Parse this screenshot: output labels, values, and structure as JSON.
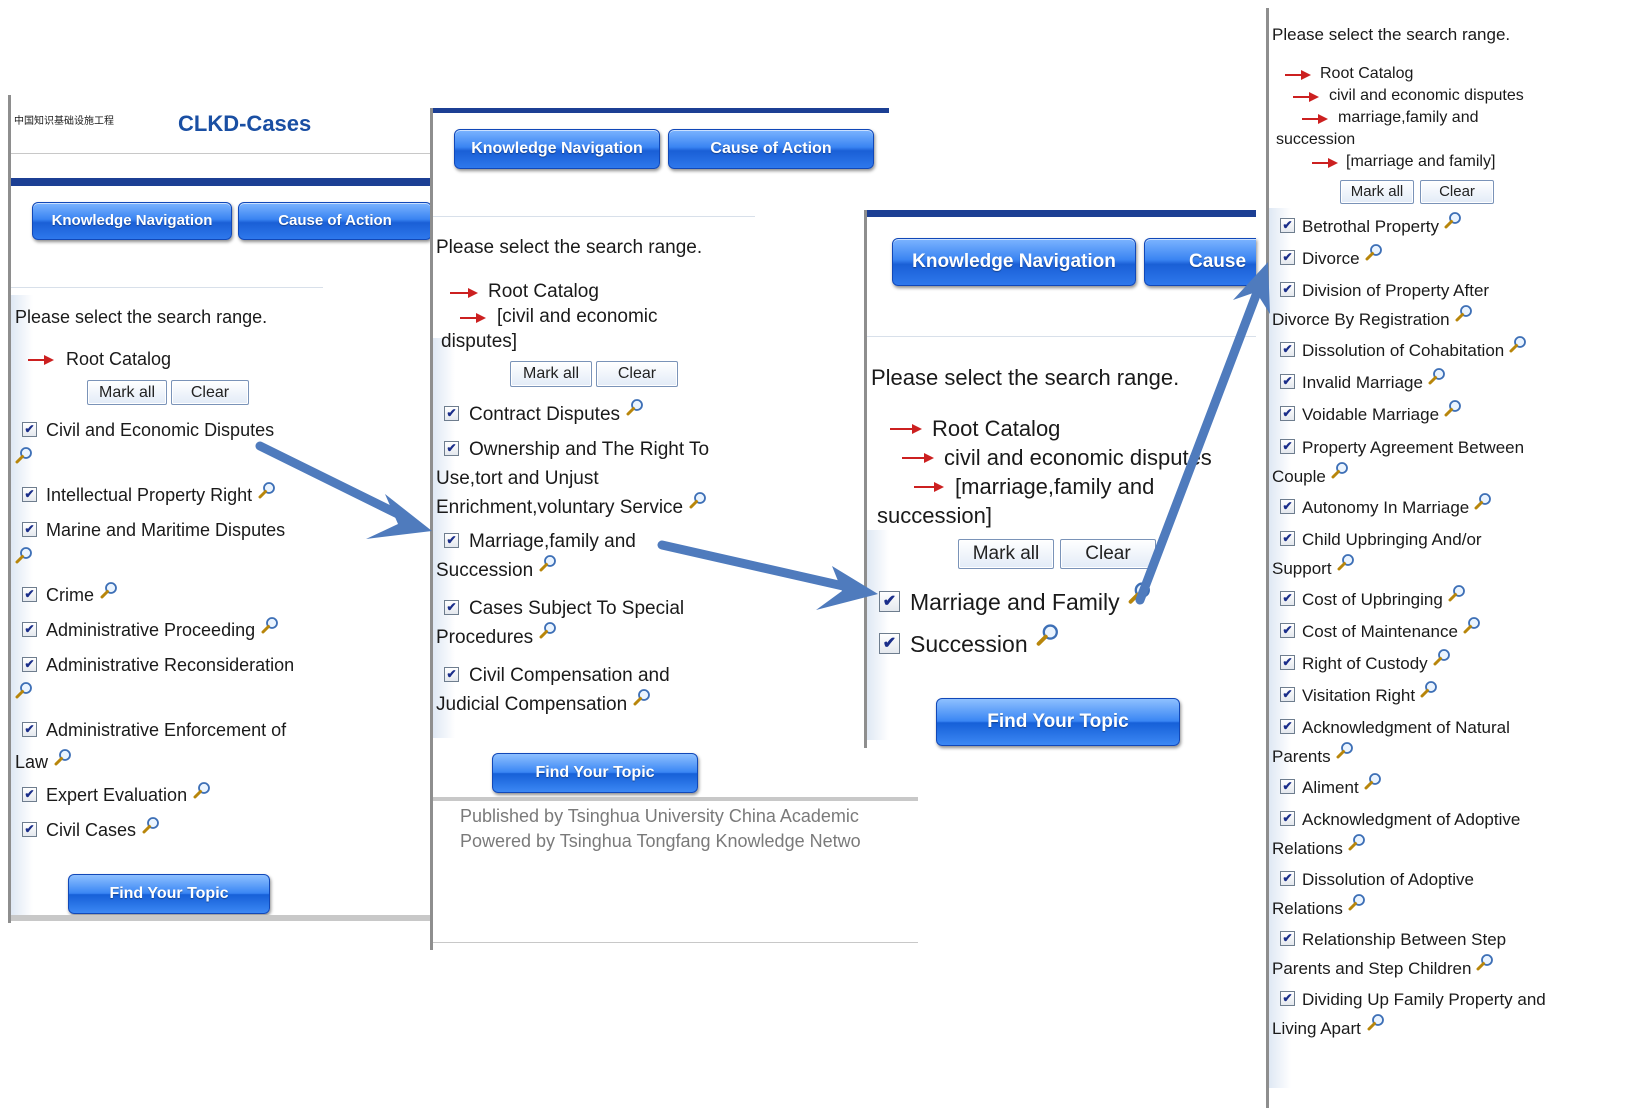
{
  "panel1": {
    "logo_cn": "中国知识基础设施工程",
    "app_title": "CLKD-Cases",
    "nav": {
      "knowledge": "Knowledge Navigation",
      "cause": "Cause of Action"
    },
    "prompt": "Please select the search range.",
    "crumbs": [
      "Root Catalog"
    ],
    "mark_all": "Mark all",
    "clear": "Clear",
    "items": [
      [
        "Civil and Economic Disputes"
      ],
      [
        "Intellectual Property Right"
      ],
      [
        "Marine and Maritime Disputes"
      ],
      [
        "Crime"
      ],
      [
        "Administrative Proceeding"
      ],
      [
        "Administrative Reconsideration"
      ],
      [
        "Administrative Enforcement of",
        "Law"
      ],
      [
        "Expert Evaluation"
      ],
      [
        "Civil Cases"
      ]
    ],
    "find": "Find Your Topic"
  },
  "panel2": {
    "nav": {
      "knowledge": "Knowledge Navigation",
      "cause": "Cause of Action"
    },
    "prompt": "Please select the search range.",
    "crumbs": [
      "Root Catalog",
      "[civil and economic",
      "disputes]"
    ],
    "mark_all": "Mark all",
    "clear": "Clear",
    "items": [
      [
        "Contract Disputes"
      ],
      [
        "Ownership and The Right To",
        "Use,tort and Unjust",
        "Enrichment,voluntary Service"
      ],
      [
        "Marriage,family and",
        "Succession"
      ],
      [
        "Cases Subject To Special",
        "Procedures"
      ],
      [
        "Civil Compensation and",
        "Judicial Compensation"
      ]
    ],
    "find": "Find Your Topic",
    "footer": [
      "Published by Tsinghua University China Academic",
      "Powered by Tsinghua Tongfang Knowledge Netwo"
    ]
  },
  "panel3": {
    "nav": {
      "knowledge": "Knowledge Navigation",
      "cause": "Cause"
    },
    "prompt": "Please select the search range.",
    "crumbs": [
      "Root Catalog",
      "civil and economic disputes",
      "[marriage,family and",
      "succession]"
    ],
    "mark_all": "Mark all",
    "clear": "Clear",
    "items": [
      [
        "Marriage and Family"
      ],
      [
        "Succession"
      ]
    ],
    "find": "Find Your Topic"
  },
  "panel4": {
    "prompt": "Please select the search range.",
    "crumbs": [
      "Root Catalog",
      "civil and economic disputes",
      "marriage,family and",
      "succession",
      "[marriage and family]"
    ],
    "mark_all": "Mark all",
    "clear": "Clear",
    "items": [
      [
        "Betrothal Property"
      ],
      [
        "Divorce"
      ],
      [
        "Division of Property After",
        "Divorce By Registration"
      ],
      [
        "Dissolution of Cohabitation"
      ],
      [
        "Invalid Marriage"
      ],
      [
        "Voidable Marriage"
      ],
      [
        "Property Agreement Between",
        "Couple"
      ],
      [
        "Autonomy In Marriage"
      ],
      [
        "Child Upbringing And/or",
        "Support"
      ],
      [
        "Cost of Upbringing"
      ],
      [
        "Cost of Maintenance"
      ],
      [
        "Right of Custody"
      ],
      [
        "Visitation Right"
      ],
      [
        "Acknowledgment of Natural",
        "Parents"
      ],
      [
        "Aliment"
      ],
      [
        "Acknowledgment of Adoptive",
        "Relations"
      ],
      [
        "Dissolution of Adoptive",
        "Relations"
      ],
      [
        "Relationship Between Step",
        "Parents and Step Children"
      ],
      [
        "Dividing Up Family Property and",
        "Living Apart"
      ]
    ]
  },
  "colors": {
    "nav_blue": "#2e78ec",
    "header_bar": "#1c3f94",
    "flow_arrow": "#4f7bbd",
    "crumb_arrow": "#cc2020",
    "title_blue": "#1a4fa3"
  }
}
